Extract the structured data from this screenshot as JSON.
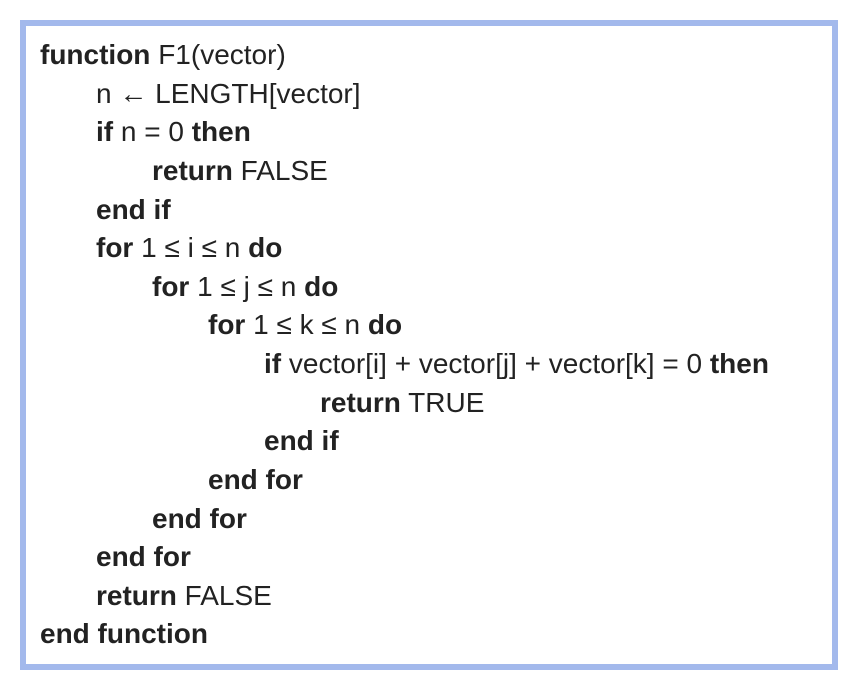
{
  "line1": {
    "kw": "function",
    "rest": " F1(vector)"
  },
  "line2": {
    "pre": "n ",
    "arrow": "←",
    "rest": " LENGTH[vector]"
  },
  "line3": {
    "kw1": "if",
    "mid": " n = 0 ",
    "kw2": "then"
  },
  "line4": {
    "kw": "return",
    "rest": " FALSE"
  },
  "line5": {
    "kw": "end if"
  },
  "line6": {
    "kw1": "for",
    "mid": " 1 ≤ i ≤ n ",
    "kw2": "do"
  },
  "line7": {
    "kw1": "for",
    "mid": " 1 ≤ j ≤ n ",
    "kw2": "do"
  },
  "line8": {
    "kw1": "for",
    "mid": " 1 ≤ k ≤ n ",
    "kw2": "do"
  },
  "line9": {
    "kw1": "if",
    "mid": " vector[i] + vector[j] + vector[k] = 0 ",
    "kw2": "then"
  },
  "line10": {
    "kw": "return",
    "rest": " TRUE"
  },
  "line11": {
    "kw": "end if"
  },
  "line12": {
    "kw": "end for"
  },
  "line13": {
    "kw": "end for"
  },
  "line14": {
    "kw": "end for"
  },
  "line15": {
    "kw": "return",
    "rest": " FALSE"
  },
  "line16": {
    "kw": "end function"
  }
}
